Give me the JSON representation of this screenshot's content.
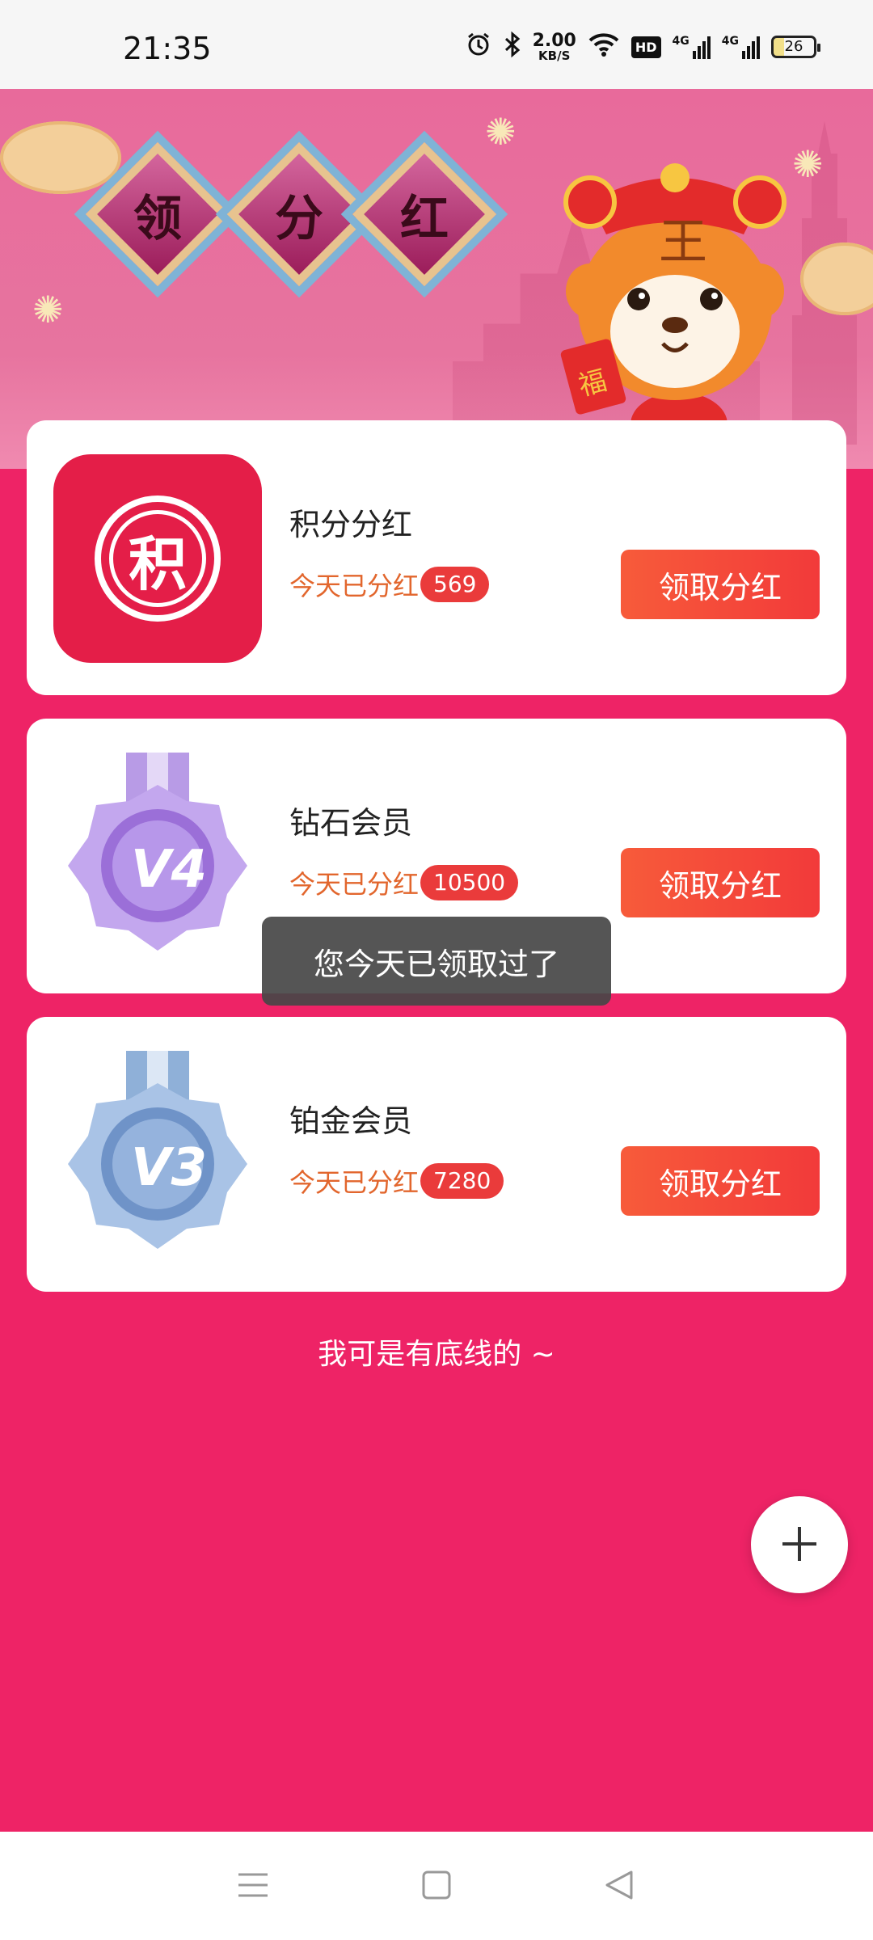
{
  "status_bar": {
    "time": "21:35",
    "speed_value": "2.00",
    "speed_unit": "KB/S",
    "hd_label": "HD",
    "network_1": "4G",
    "network_2": "4G",
    "battery": "26",
    "icons": [
      "alarm-icon",
      "bluetooth-icon",
      "wifi-icon",
      "signal-icon",
      "battery-icon"
    ]
  },
  "banner": {
    "chars": [
      "领",
      "分",
      "红"
    ],
    "mascot_badge": "福",
    "mascot_hat": "王"
  },
  "cards": [
    {
      "title": "积分分红",
      "stat_label": "今天已分红",
      "stat_value": "569",
      "button": "领取分红",
      "icon": "points-icon",
      "icon_char": "积"
    },
    {
      "title": "钻石会员",
      "stat_label": "今天已分红",
      "stat_value": "10500",
      "button": "领取分红",
      "icon": "medal-v4-icon",
      "icon_text": "V4"
    },
    {
      "title": "铂金会员",
      "stat_label": "今天已分红",
      "stat_value": "7280",
      "button": "领取分红",
      "icon": "medal-v3-icon",
      "icon_text": "V3"
    }
  ],
  "toast": "您今天已领取过了",
  "footer_note": "我可是有底线的 ~",
  "fab_icon": "plus-icon",
  "nav": [
    "menu-icon",
    "home-icon",
    "back-icon"
  ],
  "colors": {
    "background": "#ee2366",
    "banner": "#e86a9b",
    "button": "#f75b3a",
    "badge": "#ea3b3b",
    "stat_text": "#e2662d",
    "points_icon": "#e41e48"
  }
}
